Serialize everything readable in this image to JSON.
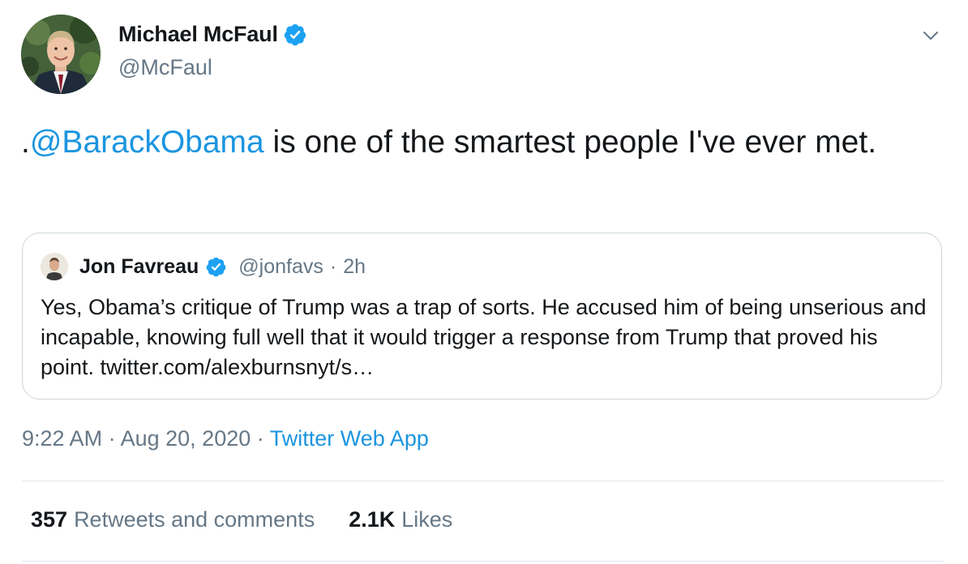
{
  "author": {
    "name": "Michael McFaul",
    "handle": "@McFaul",
    "verified_icon": "verified-badge-icon",
    "avatar_icon": "profile-photo"
  },
  "menu_icon": "chevron-down-icon",
  "tweet": {
    "prefix": ".",
    "mention": "@BarackObama",
    "text": " is one of the smartest people I've ever met."
  },
  "quoted": {
    "name": "Jon Favreau",
    "handle": "@jonfavs",
    "separator": "·",
    "time": "2h",
    "text": "Yes, Obama’s critique of Trump was a trap of sorts. He accused him of being unserious and incapable, knowing full well that it would trigger a response from Trump that proved his point. twitter.com/alexburnsnyt/s…"
  },
  "meta": {
    "time": "9:22 AM",
    "sep1": "·",
    "date": "Aug 20, 2020",
    "sep2": "·",
    "source": "Twitter Web App"
  },
  "stats": {
    "retweets_count": "357",
    "retweets_label": "Retweets and comments",
    "likes_count": "2.1K",
    "likes_label": "Likes"
  },
  "colors": {
    "link": "#1b95e0",
    "secondary_text": "#657786",
    "primary_text": "#14171a",
    "verified": "#1da1f2",
    "border": "#ccd6dd"
  }
}
